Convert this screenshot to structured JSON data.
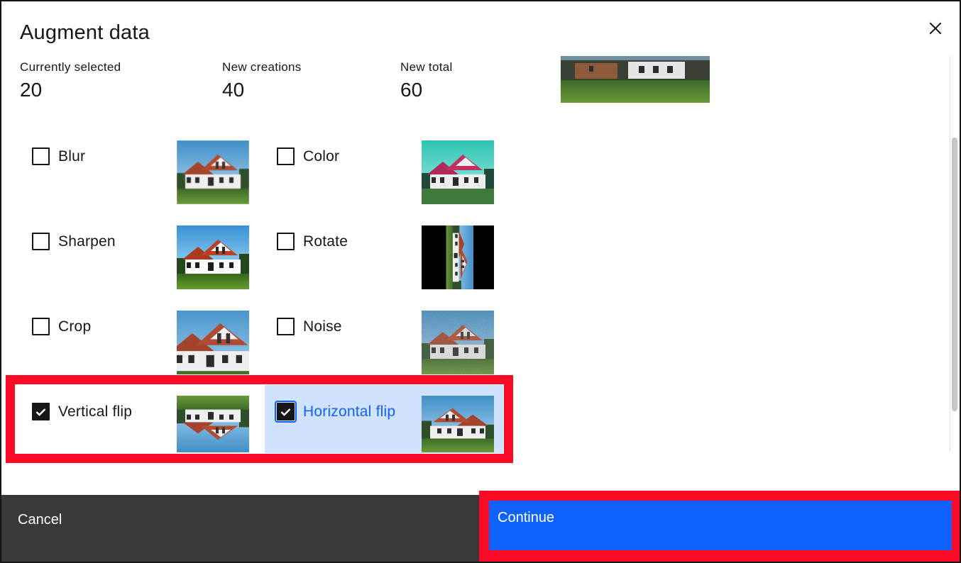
{
  "modal": {
    "title": "Augment data",
    "close_icon": "close-icon"
  },
  "stats": [
    {
      "label": "Currently selected",
      "value": "20"
    },
    {
      "label": "New creations",
      "value": "40"
    },
    {
      "label": "New total",
      "value": "60"
    }
  ],
  "options": {
    "blur": {
      "label": "Blur",
      "checked": false
    },
    "color": {
      "label": "Color",
      "checked": false
    },
    "sharpen": {
      "label": "Sharpen",
      "checked": false
    },
    "rotate": {
      "label": "Rotate",
      "checked": false
    },
    "crop": {
      "label": "Crop",
      "checked": false
    },
    "noise": {
      "label": "Noise",
      "checked": false
    },
    "vertical_flip": {
      "label": "Vertical flip",
      "checked": true
    },
    "horizontal_flip": {
      "label": "Horizontal flip",
      "checked": true
    }
  },
  "footer": {
    "cancel_label": "Cancel",
    "continue_label": "Continue"
  },
  "colors": {
    "primary": "#0f62fe",
    "selected_bg": "#d0e2ff",
    "highlight": "#fa0a24",
    "secondary_button": "#393939"
  }
}
